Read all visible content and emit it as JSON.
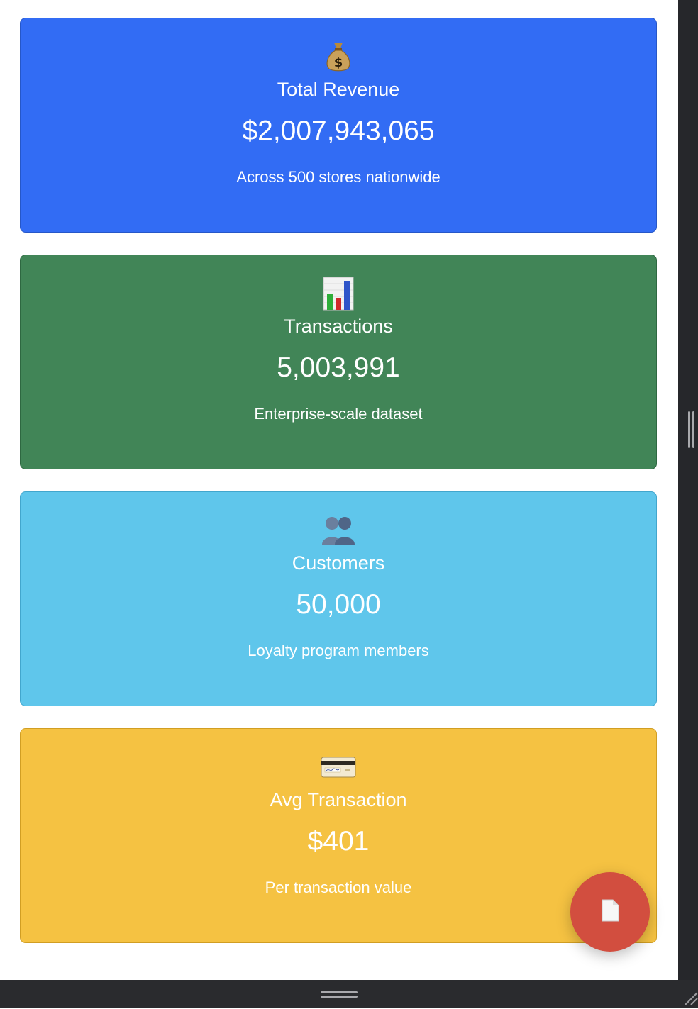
{
  "cards": [
    {
      "icon": "money-bag-icon",
      "title": "Total Revenue",
      "value": "$2,007,943,065",
      "subtitle": "Across 500 stores nationwide",
      "color": "#326cf4"
    },
    {
      "icon": "bar-chart-icon",
      "title": "Transactions",
      "value": "5,003,991",
      "subtitle": "Enterprise-scale dataset",
      "color": "#418557"
    },
    {
      "icon": "busts-in-silhouette-icon",
      "title": "Customers",
      "value": "50,000",
      "subtitle": "Loyalty program members",
      "color": "#5fc6eb"
    },
    {
      "icon": "credit-card-icon",
      "title": "Avg Transaction",
      "value": "$401",
      "subtitle": "Per transaction value",
      "color": "#f5c242"
    }
  ],
  "fab": {
    "icon": "document-icon",
    "color": "#d24e3f"
  }
}
